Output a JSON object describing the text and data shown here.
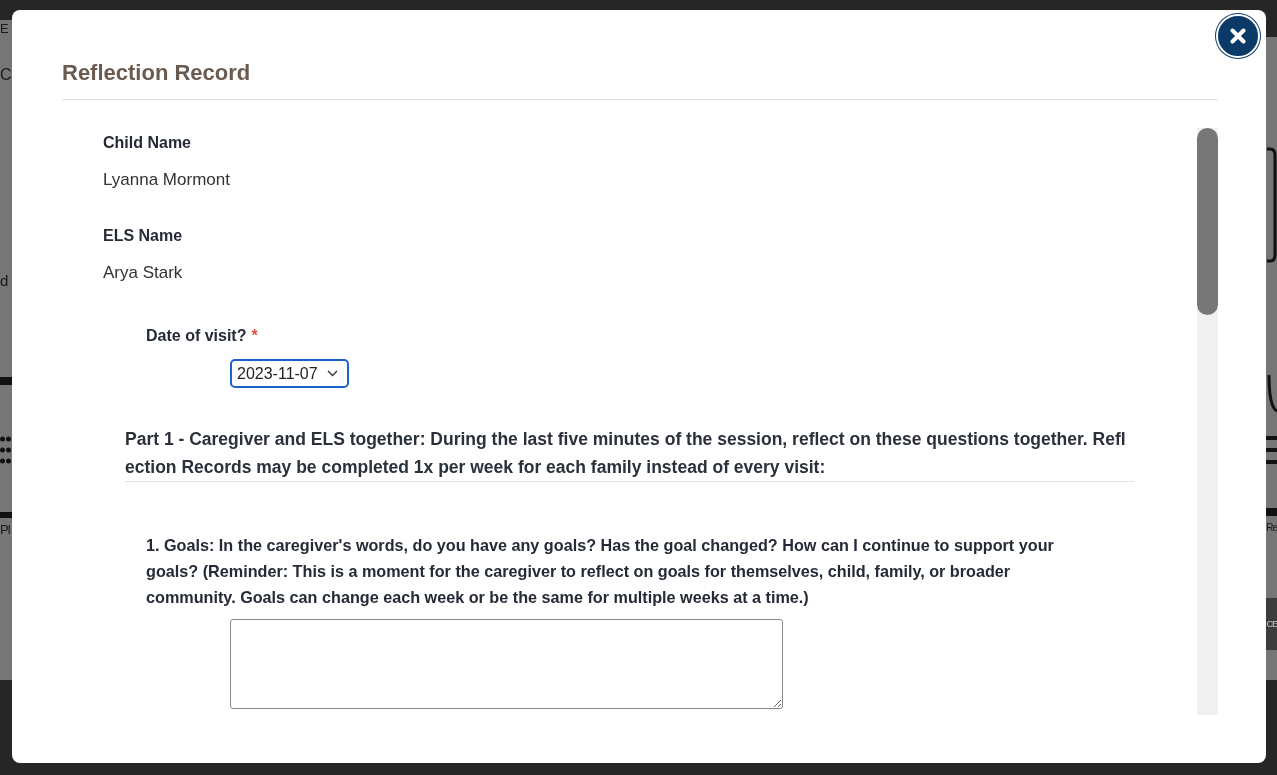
{
  "backdrop": {
    "left_texts": [
      "E",
      "C",
      "d",
      "Pl"
    ],
    "right_texts": [
      "Re",
      "CE"
    ]
  },
  "modal": {
    "title": "Reflection Record"
  },
  "fields": [
    {
      "label": "Child Name",
      "value": "Lyanna Mormont"
    },
    {
      "label": "ELS Name",
      "value": "Arya Stark"
    }
  ],
  "date_of_visit": {
    "label": "Date of visit?",
    "required_mark": "*",
    "value": "2023-11-07"
  },
  "part_1": {
    "heading": "Part 1 - Caregiver and ELS together: During the last five minutes of the session, reflect on these questions together. Reflection Records may be completed 1x per week for each family instead of every visit:",
    "questions": [
      {
        "kind": "long_text",
        "label": "1. Goals: In the caregiver's words, do you have any goals? Has the goal changed? How can I continue to support your goals? (Reminder: This is a moment for the caregiver to reflect on goals for themselves, child, family, or broader community. Goals can change each week or be the same for multiple weeks at a time.)"
      }
    ]
  }
}
